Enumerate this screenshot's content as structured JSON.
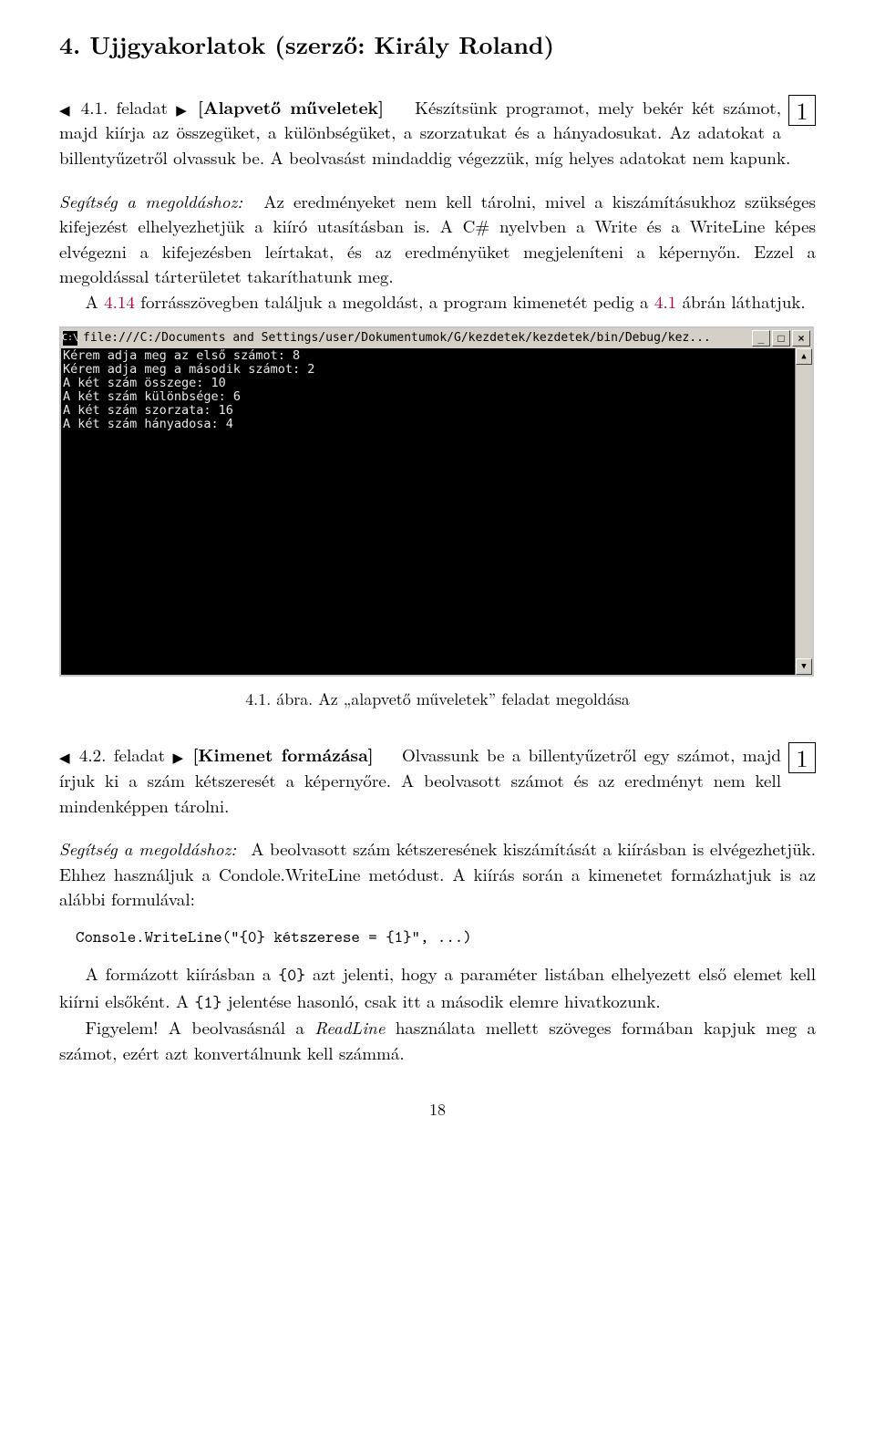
{
  "section_title": "4. Ujjgyakorlatok (szerző: Király Roland)",
  "task1": {
    "marker_left": "◀",
    "num": "4.1. feladat",
    "marker_right": "▶",
    "category": "[Alapvető műveletek]",
    "box": "1",
    "body1": "Készítsünk programot, mely bekér két számot, majd kiírja az összegüket, a különbségüket, a szorzatukat és a hányadosukat. Az adatokat a billentyűzetről olvassuk be. A beolvasást mindaddig végezzük, míg helyes adatokat nem kapunk.",
    "hint_label": "Segítség a megoldáshoz:",
    "hint_body": "Az eredményeket nem kell tárolni, mivel a kiszámításukhoz szükséges kifejezést elhelyezhetjük a kiíró utasításban is. A C# nyelvben a Write és a WriteLine képes elvégezni a kifejezésben leírtakat, és az eredményüket megjeleníteni a képernyőn. Ezzel a megoldással tárterületet takaríthatunk meg.",
    "ref_pre": "A ",
    "ref1": "4.14",
    "ref_mid": " forrásszövegben találjuk a megoldást, a program kimenetét pedig a ",
    "ref2": "4.1",
    "ref_post": " ábrán láthatjuk."
  },
  "figure": {
    "title": "file:///C:/Documents and Settings/user/Dokumentumok/G/kezdetek/kezdetek/bin/Debug/kez...",
    "console_text": "Kérem adja meg az első számot: 8\nKérem adja meg a második számot: 2\nA két szám összege: 10\nA két szám különbsége: 6\nA két szám szorzata: 16\nA két szám hányadosa: 4",
    "caption": "4.1. ábra. Az „alapvető műveletek” feladat megoldása",
    "cmd_icon": "C:\\"
  },
  "task2": {
    "marker_left": "◀",
    "num": "4.2. feladat",
    "marker_right": "▶",
    "category": "[Kimenet formázása]",
    "box": "1",
    "body1": "Olvassunk be a billentyűzetről egy számot, majd írjuk ki a szám kétszeresét a képernyőre. A beolvasott számot és az eredményt nem kell mindenképpen tárolni.",
    "hint_label": "Segítség a megoldáshoz:",
    "hint_body": "A beolvasott szám kétszeresének kiszámítását a kiírásban is elvégezhetjük. Ehhez használjuk a Condole.WriteLine metódust. A kiírás során a kimenetet formázhatjuk is az alábbi formulával:",
    "code": "Console.WriteLine(\"{0} kétszerese = {1}\", ...)",
    "para2_a": "A formázott kiírásban a ",
    "para2_m0": "{0}",
    "para2_b": " azt jelenti, hogy a paraméter listában elhelyezett első elemet kell kiírni elsőként. A ",
    "para2_m1": "{1}",
    "para2_c": " jelentése hasonló, csak itt a második elemre hivatkozunk.",
    "para3_a": "Figyelem! A beolvasásnál a ",
    "para3_it": "ReadLine",
    "para3_b": " használata mellett szöveges formában kapjuk meg a számot, ezért azt konvertálnunk kell számmá."
  },
  "pagenum": "18"
}
